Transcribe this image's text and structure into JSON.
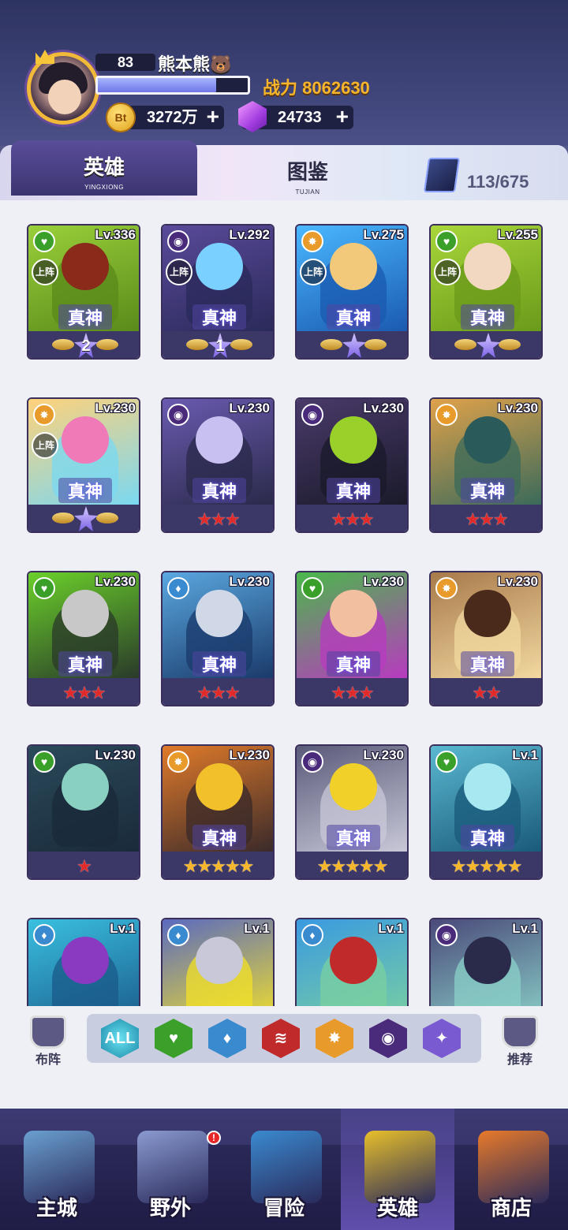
{
  "player": {
    "level": "83",
    "name": "熊本熊🐻",
    "power_label": "战力",
    "power_value": "8062630",
    "xp_fraction": 0.79
  },
  "currency": {
    "coin_symbol": "Bt",
    "coin_value": "3272万",
    "gem_value": "24733",
    "plus": "+"
  },
  "tabs": [
    {
      "label": "英雄",
      "sub": "YINGXIONG",
      "active": true
    },
    {
      "label": "图鉴",
      "sub": "TUJIAN",
      "active": false
    }
  ],
  "collection_count": "113/675",
  "badges": {
    "on_team": "上阵",
    "god": "真神"
  },
  "heroes": [
    {
      "level": "Lv.336",
      "element": "nature",
      "on_team": true,
      "god": true,
      "rank": "awaken",
      "awaken_num": "2",
      "palette": [
        "#9ad03a",
        "#5a8a1a",
        "#8a2a1a"
      ]
    },
    {
      "level": "Lv.292",
      "element": "shadow",
      "on_team": true,
      "god": true,
      "rank": "awaken",
      "awaken_num": "1",
      "palette": [
        "#5a4a9a",
        "#2a2a5a",
        "#7ad0ff"
      ]
    },
    {
      "level": "Lv.275",
      "element": "light",
      "on_team": true,
      "god": true,
      "rank": "awaken",
      "awaken_num": "",
      "palette": [
        "#4ab8ff",
        "#1a5ab0",
        "#f2c87a"
      ]
    },
    {
      "level": "Lv.255",
      "element": "nature",
      "on_team": true,
      "god": true,
      "rank": "awaken",
      "awaken_num": "",
      "palette": [
        "#a8d63a",
        "#6a9a1a",
        "#f2d8c0"
      ]
    },
    {
      "level": "Lv.230",
      "element": "light",
      "on_team": true,
      "god": true,
      "rank": "awaken",
      "awaken_num": "",
      "palette": [
        "#ffd27a",
        "#7ad8f2",
        "#f07ab8"
      ]
    },
    {
      "level": "Lv.230",
      "element": "shadow",
      "on_team": false,
      "god": true,
      "rank": "stars",
      "stars": 3,
      "star_color": "red",
      "palette": [
        "#6a5ab0",
        "#2a2a4a",
        "#c8c0f0"
      ]
    },
    {
      "level": "Lv.230",
      "element": "shadow",
      "on_team": false,
      "god": true,
      "rank": "stars",
      "stars": 3,
      "star_color": "red",
      "palette": [
        "#4a3a6a",
        "#1a1a2a",
        "#9ad02a"
      ]
    },
    {
      "level": "Lv.230",
      "element": "light",
      "on_team": false,
      "god": true,
      "rank": "stars",
      "stars": 3,
      "star_color": "red",
      "palette": [
        "#e0a24a",
        "#3a6a5a",
        "#2a5a5a"
      ]
    },
    {
      "level": "Lv.230",
      "element": "nature",
      "on_team": false,
      "god": true,
      "rank": "stars",
      "stars": 3,
      "star_color": "red",
      "palette": [
        "#6ad02a",
        "#2a3a2a",
        "#c8c8c8"
      ]
    },
    {
      "level": "Lv.230",
      "element": "water",
      "on_team": false,
      "god": true,
      "rank": "stars",
      "stars": 3,
      "star_color": "red",
      "palette": [
        "#5aa8e0",
        "#1a3a6a",
        "#d0d8e8"
      ]
    },
    {
      "level": "Lv.230",
      "element": "nature",
      "on_team": false,
      "god": true,
      "rank": "stars",
      "stars": 3,
      "star_color": "red",
      "palette": [
        "#4ab84a",
        "#b83ac0",
        "#f2c0a0"
      ]
    },
    {
      "level": "Lv.230",
      "element": "light",
      "on_team": false,
      "god": true,
      "rank": "stars",
      "stars": 2,
      "star_color": "red",
      "palette": [
        "#a87a4a",
        "#f2d8a0",
        "#4a2a1a"
      ]
    },
    {
      "level": "Lv.230",
      "element": "nature",
      "on_team": false,
      "god": false,
      "rank": "stars",
      "stars": 1,
      "star_color": "red",
      "palette": [
        "#2a4a5a",
        "#1a2a3a",
        "#8ad0c0"
      ]
    },
    {
      "level": "Lv.230",
      "element": "light",
      "on_team": false,
      "god": true,
      "rank": "stars",
      "stars": 5,
      "star_color": "gold",
      "palette": [
        "#e07a2a",
        "#3a2a2a",
        "#f2c02a"
      ]
    },
    {
      "level": "Lv.230",
      "element": "shadow",
      "on_team": false,
      "god": true,
      "rank": "stars",
      "stars": 5,
      "star_color": "gold",
      "palette": [
        "#5a5a7a",
        "#c8c8d8",
        "#f2d02a"
      ]
    },
    {
      "level": "Lv.1",
      "element": "nature",
      "on_team": false,
      "god": true,
      "rank": "stars",
      "stars": 5,
      "star_color": "gold",
      "palette": [
        "#5ab8d0",
        "#1a5a7a",
        "#a8e8f0"
      ]
    },
    {
      "level": "Lv.1",
      "element": "water",
      "on_team": false,
      "god": false,
      "rank": "none",
      "palette": [
        "#3ac0e0",
        "#1a5a8a",
        "#8a3ac0"
      ]
    },
    {
      "level": "Lv.1",
      "element": "water",
      "on_team": false,
      "god": false,
      "rank": "none",
      "palette": [
        "#5a6ac0",
        "#f2e02a",
        "#c8c8d8"
      ]
    },
    {
      "level": "Lv.1",
      "element": "water",
      "on_team": false,
      "god": false,
      "rank": "none",
      "palette": [
        "#3a9ae0",
        "#7ad0a0",
        "#c02a2a"
      ]
    },
    {
      "level": "Lv.1",
      "element": "shadow",
      "on_team": false,
      "god": false,
      "rank": "none",
      "palette": [
        "#4a4a7a",
        "#8ad0c8",
        "#2a2a4a"
      ]
    }
  ],
  "filters": {
    "left_label": "布阵",
    "right_label": "推荐",
    "all_label": "ALL",
    "options": [
      {
        "element": "all",
        "color": "#2ab8d0"
      },
      {
        "element": "nature",
        "color": "#3aa02a"
      },
      {
        "element": "water",
        "color": "#3a8ad0"
      },
      {
        "element": "fire",
        "color": "#c02a2a"
      },
      {
        "element": "light",
        "color": "#e89a2a"
      },
      {
        "element": "shadow",
        "color": "#4a2a7a"
      },
      {
        "element": "arcane",
        "color": "#7a5ad0"
      }
    ]
  },
  "element_icons": {
    "nature": "leaf-icon",
    "shadow": "eye-icon",
    "light": "sun-icon",
    "water": "drop-icon",
    "fire": "claw-icon",
    "arcane": "compass-icon"
  },
  "element_colors": {
    "nature": "#3aa02a",
    "shadow": "#4a2a7a",
    "light": "#e89a2a",
    "water": "#3a8ad0",
    "fire": "#c02a2a",
    "arcane": "#7a5ad0"
  },
  "nav": [
    {
      "label": "主城",
      "icon": "city-icon",
      "active": false,
      "color": "#6aa0d0"
    },
    {
      "label": "野外",
      "icon": "castle-icon",
      "active": false,
      "color": "#8a9ad0",
      "badge": "!"
    },
    {
      "label": "冒险",
      "icon": "monster-icon",
      "active": false,
      "color": "#3a8ad0"
    },
    {
      "label": "英雄",
      "icon": "hero-icon",
      "active": true,
      "color": "#e8c02a"
    },
    {
      "label": "商店",
      "icon": "shop-icon",
      "active": false,
      "color": "#e87a2a"
    }
  ]
}
